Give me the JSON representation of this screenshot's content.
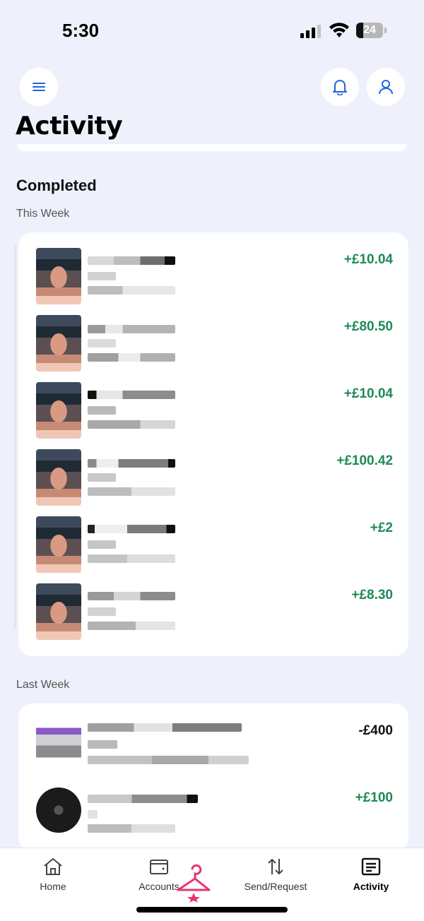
{
  "status_bar": {
    "time": "5:30",
    "battery": "24"
  },
  "header": {
    "title": "Activity"
  },
  "section": {
    "heading": "Completed"
  },
  "this_week": {
    "label": "This Week",
    "transactions": [
      {
        "amount": "+£10.04"
      },
      {
        "amount": "+£80.50"
      },
      {
        "amount": "+£10.04"
      },
      {
        "amount": "+£100.42"
      },
      {
        "amount": "+£2"
      },
      {
        "amount": "+£8.30"
      }
    ]
  },
  "last_week": {
    "label": "Last Week",
    "transactions": [
      {
        "amount": "-£400"
      },
      {
        "amount": "+£100"
      }
    ]
  },
  "nav": {
    "home": "Home",
    "accounts": "Accounts",
    "send_request": "Send/Request",
    "activity": "Activity"
  },
  "colors": {
    "positive": "#1e8a56",
    "accent": "#1f63e0",
    "background": "#eef1fb"
  },
  "icons": [
    "menu-icon",
    "bell-icon",
    "profile-icon",
    "home-icon",
    "wallet-icon",
    "transfer-icon",
    "receipt-icon",
    "hanger-logo"
  ]
}
